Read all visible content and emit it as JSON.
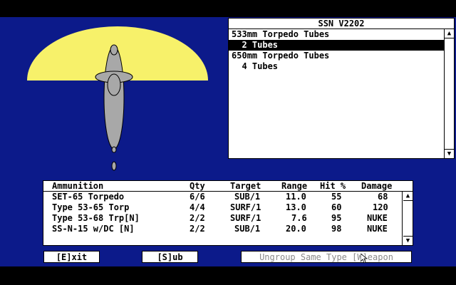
{
  "weapon_slots": {
    "title": "SSN V2202",
    "rows": [
      {
        "text": "533mm Torpedo Tubes"
      },
      {
        "text": "  2 Tubes"
      },
      {
        "text": "650mm Torpedo Tubes"
      },
      {
        "text": "  4 Tubes"
      }
    ],
    "selected": 1
  },
  "ammunition": {
    "headers": {
      "name": "Ammunition",
      "qty": "Qty",
      "target": "Target",
      "range": "Range",
      "hit": "Hit %",
      "damage": "Damage"
    },
    "rows": [
      {
        "name": "SET-65 Torpedo",
        "qty": "6/6",
        "target": "SUB/1",
        "range": "11.0",
        "hit": "55",
        "damage": "68"
      },
      {
        "name": "Type 53-65 Torp",
        "qty": "4/4",
        "target": "SURF/1",
        "range": "13.0",
        "hit": "60",
        "damage": "120"
      },
      {
        "name": "Type 53-68 Trp[N]",
        "qty": "2/2",
        "target": "SURF/1",
        "range": "7.6",
        "hit": "95",
        "damage": "NUKE"
      },
      {
        "name": "SS-N-15 w/DC [N]",
        "qty": "2/2",
        "target": "SUB/1",
        "range": "20.0",
        "hit": "98",
        "damage": "NUKE"
      }
    ]
  },
  "buttons": {
    "exit": "[E]xit",
    "sub": "[S]ub",
    "ungroup": "Ungroup Same Type [W]eapon"
  },
  "icons": {
    "scroll_up": "up-arrow-icon",
    "scroll_down": "down-arrow-icon",
    "cursor": "mouse-pointer-icon"
  },
  "colors": {
    "background": "#0c1a8a",
    "sonar_arc": "#f7f16a",
    "submarine": "#a8a8a8"
  }
}
